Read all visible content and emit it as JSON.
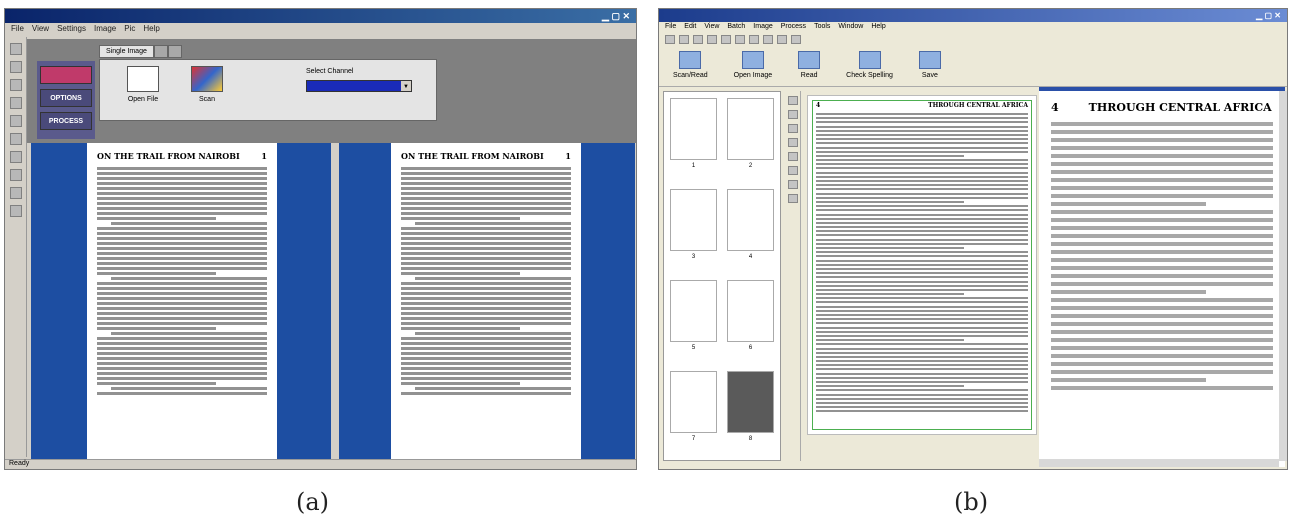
{
  "panel_a": {
    "title": "",
    "menu": [
      "File",
      "View",
      "Settings",
      "Image",
      "Pic",
      "Help"
    ],
    "side_buttons": [
      "",
      "OPTIONS",
      "PROCESS"
    ],
    "tabs": [
      "Single Image",
      "",
      ""
    ],
    "tools": [
      {
        "label": "Open File"
      },
      {
        "label": "Scan"
      }
    ],
    "color_label": "Select Channel",
    "color_value": "",
    "page_header_left": "ON THE TRAIL FROM NAIROBI",
    "page_header_right": "ON THE TRAIL FROM NAIROBI",
    "page_number": "1",
    "status": "Ready"
  },
  "panel_b": {
    "title": "",
    "menu": [
      "File",
      "Edit",
      "View",
      "Batch",
      "Image",
      "Process",
      "Tools",
      "Window",
      "Help"
    ],
    "tools": [
      "Scan/Read",
      "Open Image",
      "Read",
      "Check Spelling",
      "Save"
    ],
    "page_number": "4",
    "page_title": "THROUGH CENTRAL AFRICA",
    "thumb_numbers": [
      "1",
      "2",
      "3",
      "4",
      "5",
      "6",
      "7",
      "8"
    ]
  },
  "captions": {
    "a": "(a)",
    "b": "(b)"
  },
  "colors": {
    "page_pane_blue": "#1d4ea2",
    "selection_green": "#4caf50"
  }
}
